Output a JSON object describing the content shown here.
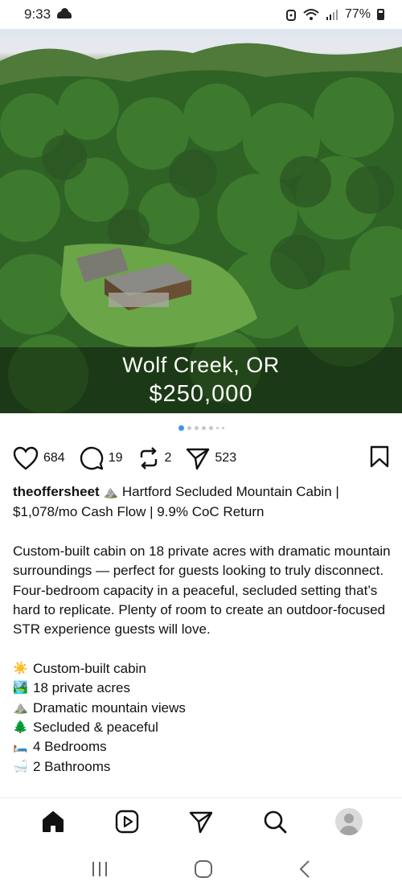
{
  "status_bar": {
    "time": "9:33",
    "battery": "77%"
  },
  "post": {
    "location": "Wolf Creek, OR",
    "price": "$250,000",
    "likes": "684",
    "comments": "19",
    "reposts": "2",
    "shares": "523",
    "username": "theoffersheet",
    "headline_line1": "Hartford Secluded Mountain Cabin |",
    "headline_line2": "$1,078/mo Cash Flow | 9.9% CoC Return",
    "para1": "Custom-built cabin on 18 private acres with dramatic mountain surroundings — perfect for guests looking to truly disconnect.",
    "para2": "Four-bedroom capacity in a peaceful, secluded setting that’s hard to replicate. Plenty of room to create an outdoor-focused STR experience guests will love.",
    "features": [
      {
        "emoji": "☀️",
        "text": "Custom-built cabin"
      },
      {
        "emoji": "🏞️",
        "text": "18 private acres"
      },
      {
        "emoji": "⛰️",
        "text": "Dramatic mountain views"
      },
      {
        "emoji": "🌲",
        "text": "Secluded & peaceful"
      },
      {
        "emoji": "🛏️",
        "text": "4 Bedrooms"
      },
      {
        "emoji": "🛁",
        "text": "2 Bathrooms"
      }
    ],
    "username_emoji": "⛰️"
  },
  "colors": {
    "accent_dot": "#3897f0",
    "text": "#111111"
  },
  "icons": {
    "heart": "heart-icon",
    "comment": "comment-icon",
    "repost": "repost-icon",
    "share": "send-icon",
    "bookmark": "bookmark-icon",
    "home": "home-icon",
    "reels": "reels-icon",
    "direct": "send-icon",
    "search": "search-icon",
    "profile": "avatar"
  }
}
